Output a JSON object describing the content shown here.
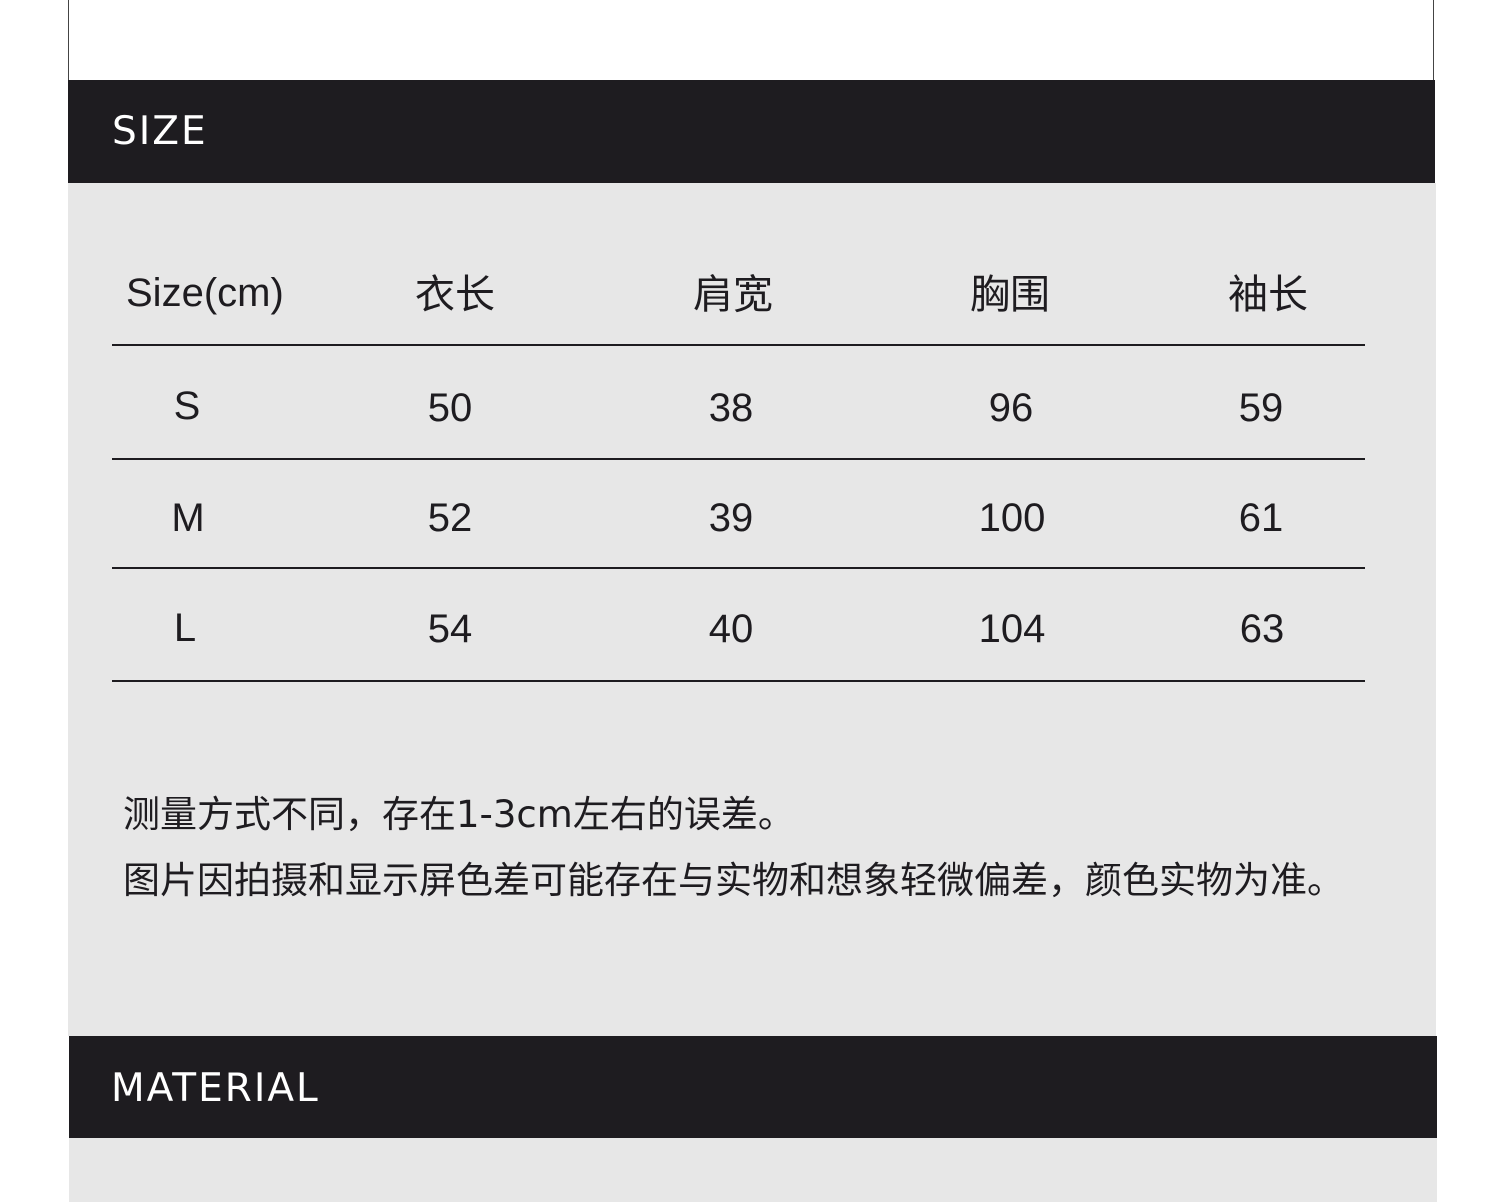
{
  "size_section": {
    "title": "SIZE",
    "table": {
      "headers": [
        "Size(cm)",
        "衣长",
        "肩宽",
        "胸围",
        "袖长"
      ],
      "rows": [
        {
          "size": "S",
          "length": "50",
          "shoulder": "38",
          "chest": "96",
          "sleeve": "59"
        },
        {
          "size": "M",
          "length": "52",
          "shoulder": "39",
          "chest": "100",
          "sleeve": "61"
        },
        {
          "size": "L",
          "length": "54",
          "shoulder": "40",
          "chest": "104",
          "sleeve": "63"
        }
      ]
    },
    "notes": [
      "测量方式不同，存在1-3cm左右的误差。",
      "图片因拍摄和显示屏色差可能存在与实物和想象轻微偏差，颜色实物为准。"
    ]
  },
  "material_section": {
    "title": "MATERIAL"
  },
  "colors": {
    "banner": "#1e1c20",
    "panel": "#e7e7e7",
    "text": "#1e1c20"
  }
}
